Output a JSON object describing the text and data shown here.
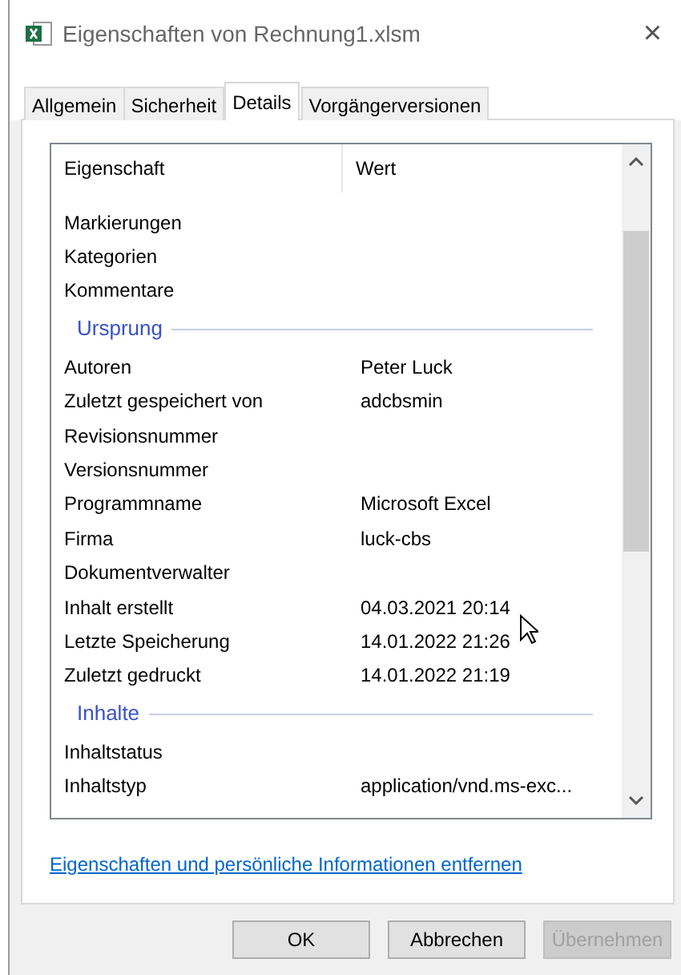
{
  "window": {
    "title": "Eigenschaften von Rechnung1.xlsm",
    "close": "×"
  },
  "tabs": [
    {
      "label": "Allgemein",
      "selected": false
    },
    {
      "label": "Sicherheit",
      "selected": false
    },
    {
      "label": "Details",
      "selected": true
    },
    {
      "label": "Vorgängerversionen",
      "selected": false
    }
  ],
  "table": {
    "columns": [
      "Eigenschaft",
      "Wert"
    ],
    "rows": [
      {
        "kind": "property",
        "name": "Markierungen",
        "value": ""
      },
      {
        "kind": "property",
        "name": "Kategorien",
        "value": ""
      },
      {
        "kind": "property",
        "name": "Kommentare",
        "value": ""
      },
      {
        "kind": "group",
        "name": "Ursprung"
      },
      {
        "kind": "property",
        "name": "Autoren",
        "value": "Peter Luck"
      },
      {
        "kind": "property",
        "name": "Zuletzt gespeichert von",
        "value": "adcbsmin"
      },
      {
        "kind": "property",
        "name": "Revisionsnummer",
        "value": ""
      },
      {
        "kind": "property",
        "name": "Versionsnummer",
        "value": ""
      },
      {
        "kind": "property",
        "name": "Programmname",
        "value": "Microsoft Excel"
      },
      {
        "kind": "property",
        "name": "Firma",
        "value": "luck-cbs"
      },
      {
        "kind": "property",
        "name": "Dokumentverwalter",
        "value": ""
      },
      {
        "kind": "property",
        "name": "Inhalt erstellt",
        "value": "04.03.2021 20:14"
      },
      {
        "kind": "property",
        "name": "Letzte Speicherung",
        "value": "14.01.2022 21:26"
      },
      {
        "kind": "property",
        "name": "Zuletzt gedruckt",
        "value": "14.01.2022 21:19"
      },
      {
        "kind": "group",
        "name": "Inhalte"
      },
      {
        "kind": "property",
        "name": "Inhaltstatus",
        "value": ""
      },
      {
        "kind": "property",
        "name": "Inhaltstyp",
        "value": "application/vnd.ms-exc..."
      }
    ]
  },
  "link": "Eigenschaften und persönliche Informationen entfernen",
  "buttons": [
    {
      "label": "OK",
      "disabled": false
    },
    {
      "label": "Abbrechen",
      "disabled": false
    },
    {
      "label": "Übernehmen",
      "disabled": true
    }
  ]
}
